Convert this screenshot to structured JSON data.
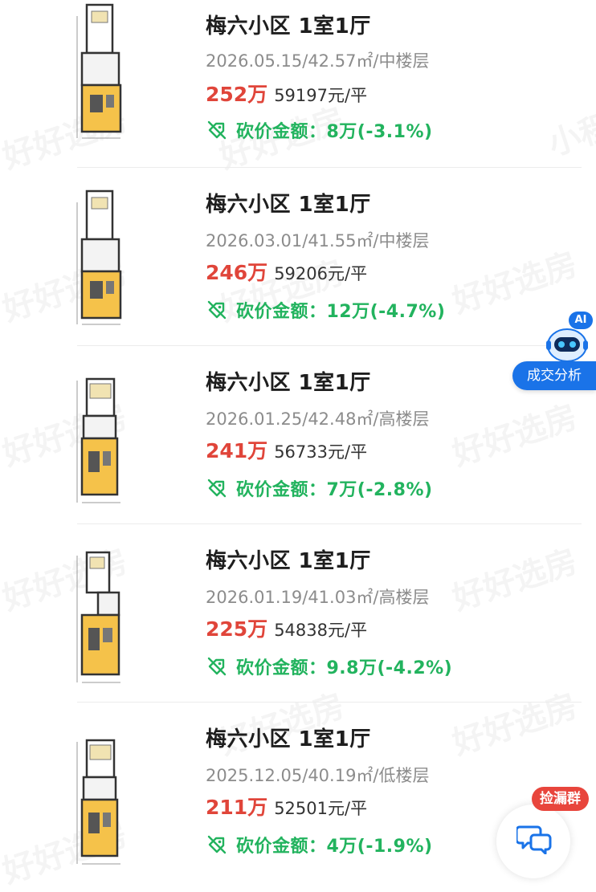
{
  "listings": [
    {
      "title": "梅六小区 1室1厅",
      "meta": "2026.05.15/42.57㎡/中楼层",
      "price": "252万",
      "unit_price": "59197元/平",
      "cut_label": "砍价金额：8万(-3.1%)"
    },
    {
      "title": "梅六小区 1室1厅",
      "meta": "2026.03.01/41.55㎡/中楼层",
      "price": "246万",
      "unit_price": "59206元/平",
      "cut_label": "砍价金额：12万(-4.7%)"
    },
    {
      "title": "梅六小区 1室1厅",
      "meta": "2026.01.25/42.48㎡/高楼层",
      "price": "241万",
      "unit_price": "56733元/平",
      "cut_label": "砍价金额：7万(-2.8%)"
    },
    {
      "title": "梅六小区 1室1厅",
      "meta": "2026.01.19/41.03㎡/高楼层",
      "price": "225万",
      "unit_price": "54838元/平",
      "cut_label": "砍价金额：9.8万(-4.2%)"
    },
    {
      "title": "梅六小区 1室1厅",
      "meta": "2025.12.05/40.19㎡/低楼层",
      "price": "211万",
      "unit_price": "52501元/平",
      "cut_label": "砍价金额：4万(-1.9%)"
    }
  ],
  "ai_widget": {
    "badge": "AI",
    "label": "成交分析"
  },
  "leak_widget": {
    "badge": "捡漏群"
  },
  "watermark": {
    "brand": "好好选房",
    "mini": "小程序"
  },
  "icons": {
    "floorplan": "floorplan-thumbnail",
    "cut": "price-tag-slash-icon",
    "robot": "ai-robot-icon",
    "chat": "chat-bubbles-icon"
  },
  "colors": {
    "price": "#e0453a",
    "cut": "#22b35e",
    "accent": "#1a73e8",
    "badge_red": "#e8453c"
  }
}
